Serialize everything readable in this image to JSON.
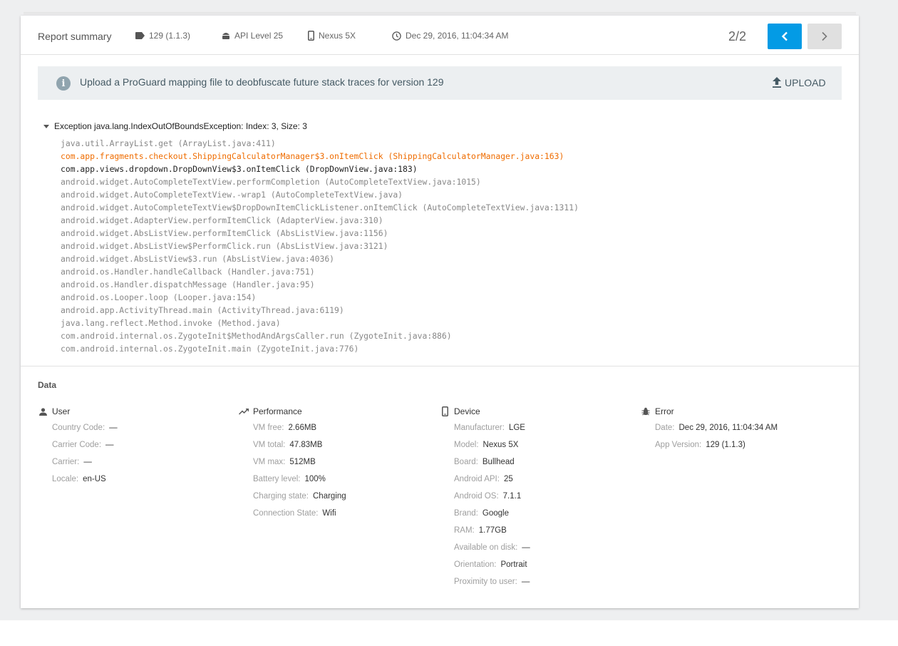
{
  "header": {
    "title": "Report summary",
    "version": "129 (1.1.3)",
    "api_level": "API Level 25",
    "device": "Nexus 5X",
    "timestamp": "Dec 29, 2016, 11:04:34 AM",
    "pager": "2/2",
    "icons": [
      "tag-icon",
      "android-icon",
      "phone-icon",
      "clock-icon",
      "chevron-left-icon",
      "chevron-right-icon"
    ]
  },
  "banner": {
    "message": "Upload a ProGuard mapping file to deobfuscate future stack traces for version 129",
    "upload_label": "UPLOAD"
  },
  "exception": {
    "title": "Exception java.lang.IndexOutOfBoundsException: Index: 3, Size: 3",
    "frames": [
      {
        "text": "java.util.ArrayList.get (ArrayList.java:411)",
        "style": "normal"
      },
      {
        "text": "com.app.fragments.checkout.ShippingCalculatorManager$3.onItemClick (ShippingCalculatorManager.java:163)",
        "style": "orange"
      },
      {
        "text": "com.app.views.dropdown.DropDownView$3.onItemClick (DropDownView.java:183)",
        "style": "dark"
      },
      {
        "text": "android.widget.AutoCompleteTextView.performCompletion (AutoCompleteTextView.java:1015)",
        "style": "normal"
      },
      {
        "text": "android.widget.AutoCompleteTextView.-wrap1 (AutoCompleteTextView.java)",
        "style": "normal"
      },
      {
        "text": "android.widget.AutoCompleteTextView$DropDownItemClickListener.onItemClick (AutoCompleteTextView.java:1311)",
        "style": "normal"
      },
      {
        "text": "android.widget.AdapterView.performItemClick (AdapterView.java:310)",
        "style": "normal"
      },
      {
        "text": "android.widget.AbsListView.performItemClick (AbsListView.java:1156)",
        "style": "normal"
      },
      {
        "text": "android.widget.AbsListView$PerformClick.run (AbsListView.java:3121)",
        "style": "normal"
      },
      {
        "text": "android.widget.AbsListView$3.run (AbsListView.java:4036)",
        "style": "normal"
      },
      {
        "text": "android.os.Handler.handleCallback (Handler.java:751)",
        "style": "normal"
      },
      {
        "text": "android.os.Handler.dispatchMessage (Handler.java:95)",
        "style": "normal"
      },
      {
        "text": "android.os.Looper.loop (Looper.java:154)",
        "style": "normal"
      },
      {
        "text": "android.app.ActivityThread.main (ActivityThread.java:6119)",
        "style": "normal"
      },
      {
        "text": "java.lang.reflect.Method.invoke (Method.java)",
        "style": "normal"
      },
      {
        "text": "com.android.internal.os.ZygoteInit$MethodAndArgsCaller.run (ZygoteInit.java:886)",
        "style": "normal"
      },
      {
        "text": "com.android.internal.os.ZygoteInit.main (ZygoteInit.java:776)",
        "style": "normal"
      }
    ]
  },
  "data": {
    "title": "Data",
    "sections": [
      {
        "name": "User",
        "icon": "person-icon",
        "rows": [
          {
            "k": "Country Code:",
            "v": "—"
          },
          {
            "k": "Carrier Code:",
            "v": "—"
          },
          {
            "k": "Carrier:",
            "v": "—"
          },
          {
            "k": "Locale:",
            "v": "en-US"
          }
        ]
      },
      {
        "name": "Performance",
        "icon": "trending-up-icon",
        "rows": [
          {
            "k": "VM free:",
            "v": "2.66MB"
          },
          {
            "k": "VM total:",
            "v": "47.83MB"
          },
          {
            "k": "VM max:",
            "v": "512MB"
          },
          {
            "k": "Battery level:",
            "v": "100%"
          },
          {
            "k": "Charging state:",
            "v": "Charging"
          },
          {
            "k": "Connection State:",
            "v": "Wifi"
          }
        ]
      },
      {
        "name": "Device",
        "icon": "phone-icon",
        "rows": [
          {
            "k": "Manufacturer:",
            "v": "LGE"
          },
          {
            "k": "Model:",
            "v": "Nexus 5X"
          },
          {
            "k": "Board:",
            "v": "Bullhead"
          },
          {
            "k": "Android API:",
            "v": "25"
          },
          {
            "k": "Android OS:",
            "v": "7.1.1"
          },
          {
            "k": "Brand:",
            "v": "Google"
          },
          {
            "k": "RAM:",
            "v": "1.77GB"
          },
          {
            "k": "Available on disk:",
            "v": "—"
          },
          {
            "k": "Orientation:",
            "v": "Portrait"
          },
          {
            "k": "Proximity to user:",
            "v": "—"
          }
        ]
      },
      {
        "name": "Error",
        "icon": "bug-icon",
        "rows": [
          {
            "k": "Date:",
            "v": "Dec 29, 2016, 11:04:34 AM"
          },
          {
            "k": "App Version:",
            "v": "129 (1.1.3)"
          }
        ]
      }
    ]
  },
  "colors": {
    "accent": "#039be5",
    "highlight_frame": "#ef6c00",
    "banner_bg": "#eceff1"
  }
}
